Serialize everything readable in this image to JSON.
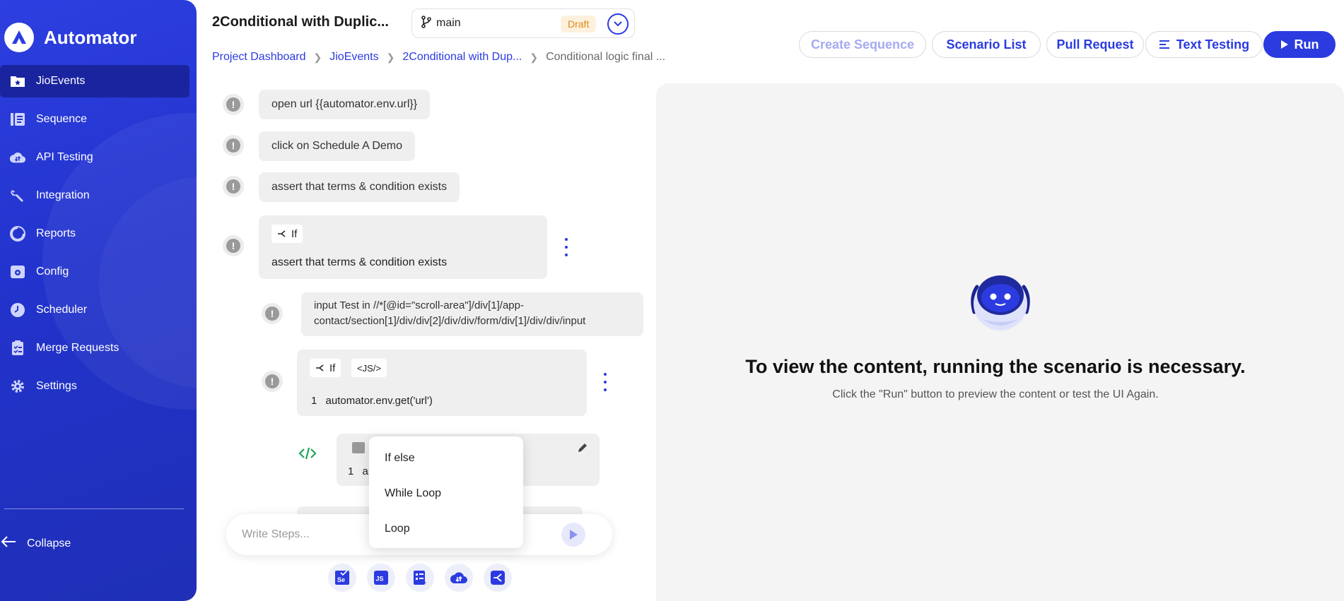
{
  "app": {
    "name": "Automator"
  },
  "sidebar": {
    "items": [
      {
        "label": "JioEvents",
        "icon": "star-folder-icon",
        "active": true
      },
      {
        "label": "Sequence",
        "icon": "sequence-icon",
        "active": false
      },
      {
        "label": "API Testing",
        "icon": "cloud-api-icon",
        "active": false
      },
      {
        "label": "Integration",
        "icon": "wrench-icon",
        "active": false
      },
      {
        "label": "Reports",
        "icon": "pie-chart-icon",
        "active": false
      },
      {
        "label": "Config",
        "icon": "config-icon",
        "active": false
      },
      {
        "label": "Scheduler",
        "icon": "clock-icon",
        "active": false
      },
      {
        "label": "Merge Requests",
        "icon": "clipboard-icon",
        "active": false
      },
      {
        "label": "Settings",
        "icon": "gear-icon",
        "active": false
      }
    ],
    "collapse_label": "Collapse"
  },
  "header": {
    "title": "2Conditional with Duplic...",
    "branch": "main",
    "status_badge": "Draft",
    "breadcrumb": [
      "Project Dashboard",
      "JioEvents",
      "2Conditional with Dup...",
      "Conditional logic final ..."
    ],
    "buttons": {
      "create_sequence": "Create Sequence",
      "scenario_list": "Scenario List",
      "pull_request": "Pull Request",
      "text_testing": "Text Testing",
      "run": "Run"
    }
  },
  "steps": {
    "step1": "open url {{automator.env.url}}",
    "step2": "click on Schedule A Demo",
    "step3": "assert that terms & condition exists",
    "if_block": {
      "chip": "If",
      "text": "assert that terms & condition exists"
    },
    "nested_input": "input Test in //*[@id=\"scroll-area\"]/div[1]/app-contact/section[1]/div/div[2]/div/div/form/div[1]/div/div/input",
    "js_if_block": {
      "chip": "If",
      "js_chip": "<JS/>",
      "line_no": "1",
      "code": "automator.env.get('url')"
    },
    "code_block": {
      "line_no": "1",
      "code_partial": "ar"
    }
  },
  "dropdown": {
    "items": [
      "If else",
      "While Loop",
      "Loop"
    ]
  },
  "composer": {
    "placeholder": "Write Steps..."
  },
  "toolbar": {
    "tools": [
      "selenium-icon",
      "javascript-icon",
      "sequence-icon",
      "cloud-api-icon",
      "branch-icon"
    ]
  },
  "preview": {
    "title": "To view the content, running the scenario is necessary.",
    "subtitle": "Click the \"Run\" button to preview the content or test the UI Again."
  },
  "colors": {
    "accent": "#2b3be0",
    "sidebar": "#2233cc",
    "draft_bg": "#fdf1de",
    "draft_text": "#e08a1a"
  }
}
